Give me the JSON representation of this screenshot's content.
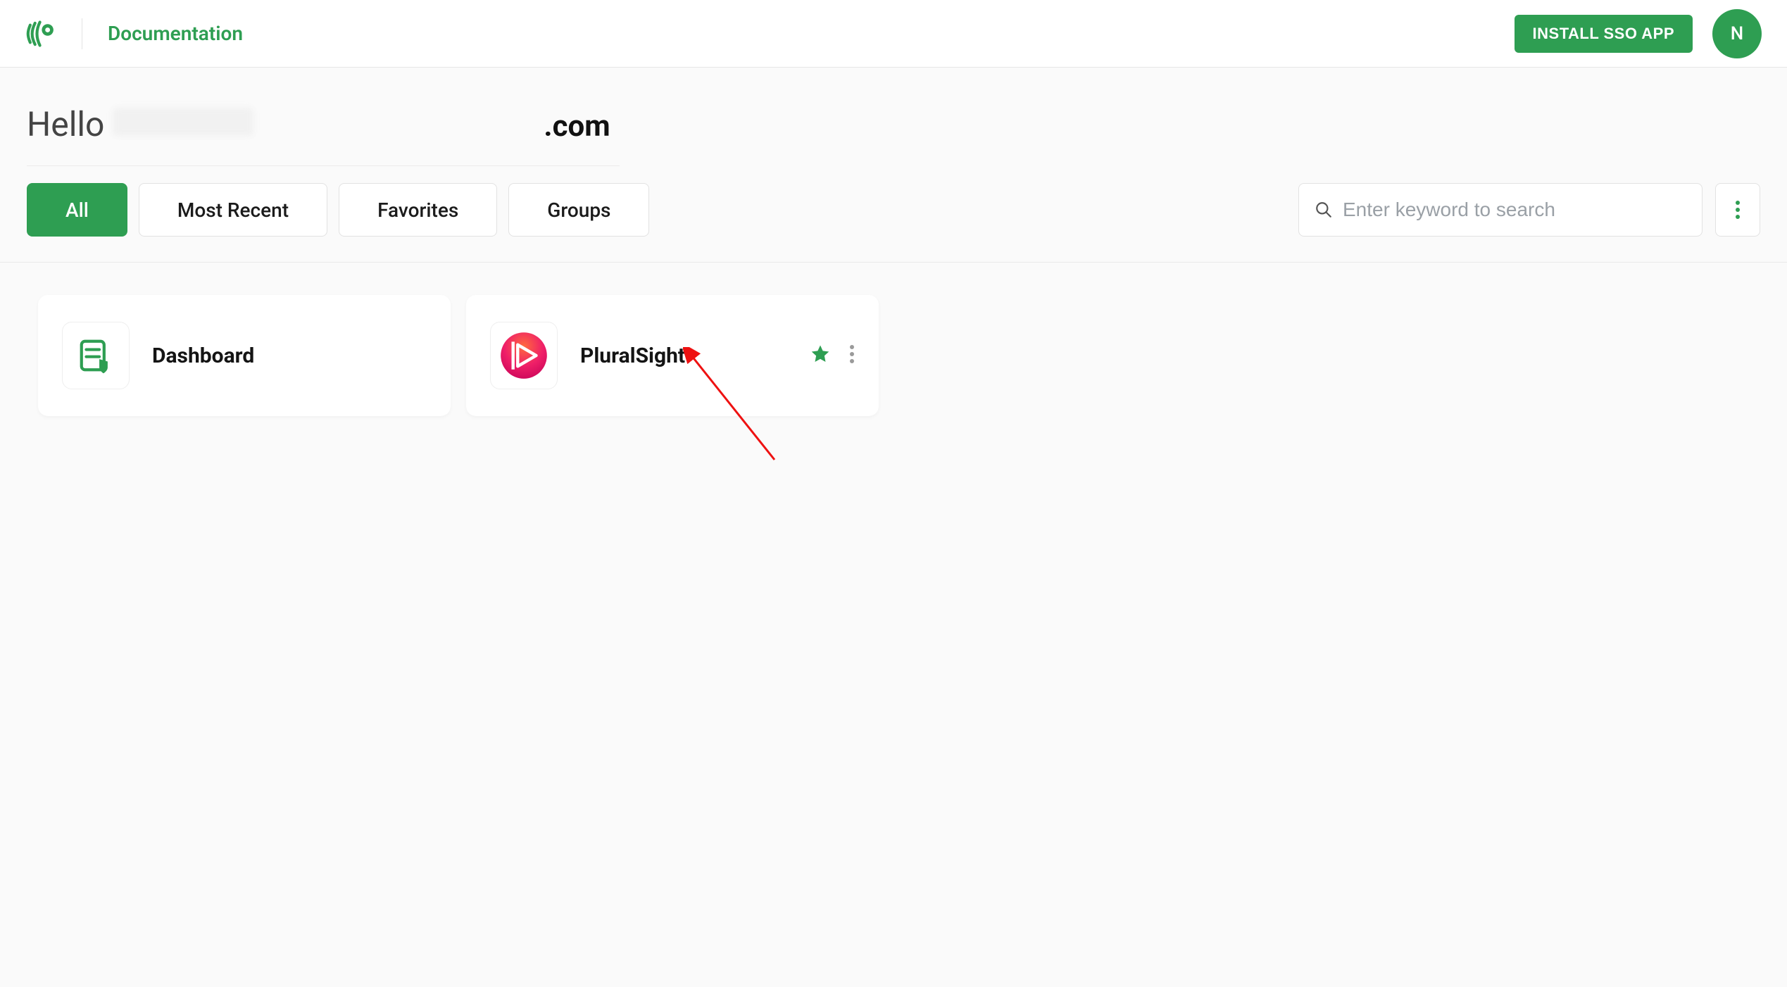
{
  "header": {
    "documentation_label": "Documentation",
    "install_button_label": "INSTALL SSO APP",
    "avatar_initial": "N"
  },
  "greeting": {
    "hello_label": "Hello",
    "domain_suffix": ".com"
  },
  "filters": {
    "tabs": [
      {
        "key": "all",
        "label": "All"
      },
      {
        "key": "recent",
        "label": "Most Recent"
      },
      {
        "key": "favorites",
        "label": "Favorites"
      },
      {
        "key": "groups",
        "label": "Groups"
      }
    ],
    "active_tab": "all",
    "search_placeholder": "Enter keyword to search"
  },
  "apps": [
    {
      "key": "dashboard",
      "title": "Dashboard",
      "icon": "dashboard-shield",
      "icon_color": "#2e9e52",
      "favorite": false,
      "show_actions": false
    },
    {
      "key": "pluralsight",
      "title": "PluralSight",
      "icon": "pluralsight",
      "icon_color": "#e61c5d",
      "favorite": true,
      "show_actions": true
    }
  ]
}
